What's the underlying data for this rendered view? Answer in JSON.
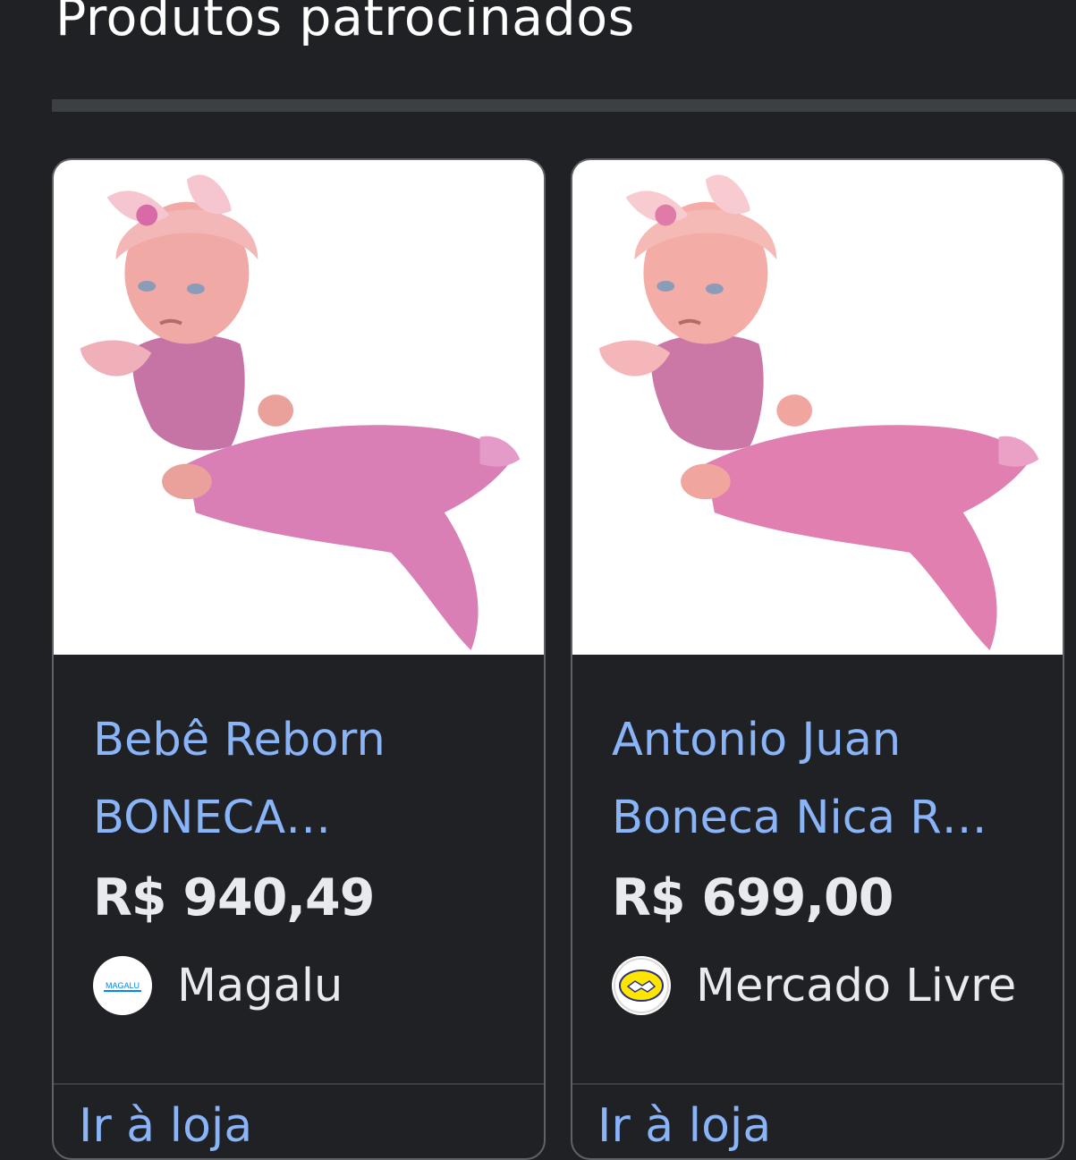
{
  "section": {
    "title": "Produtos patrocinados"
  },
  "products": [
    {
      "title_line1": "Bebê Reborn",
      "title_line2": "BONECA…",
      "price": "R$ 940,49",
      "merchant": "Magalu",
      "merchant_logo_text": "MAGALU",
      "store_link": "Ir à loja",
      "icon": "doll-product-image"
    },
    {
      "title_line1": "Antonio Juan",
      "title_line2": "Boneca Nica R…",
      "price": "R$ 699,00",
      "merchant": "Mercado Livre",
      "store_link": "Ir à loja",
      "icon": "doll-product-image"
    }
  ],
  "colors": {
    "background": "#202124",
    "link": "#8ab4f8",
    "text": "#e8eaed",
    "divider": "#3c4043"
  }
}
